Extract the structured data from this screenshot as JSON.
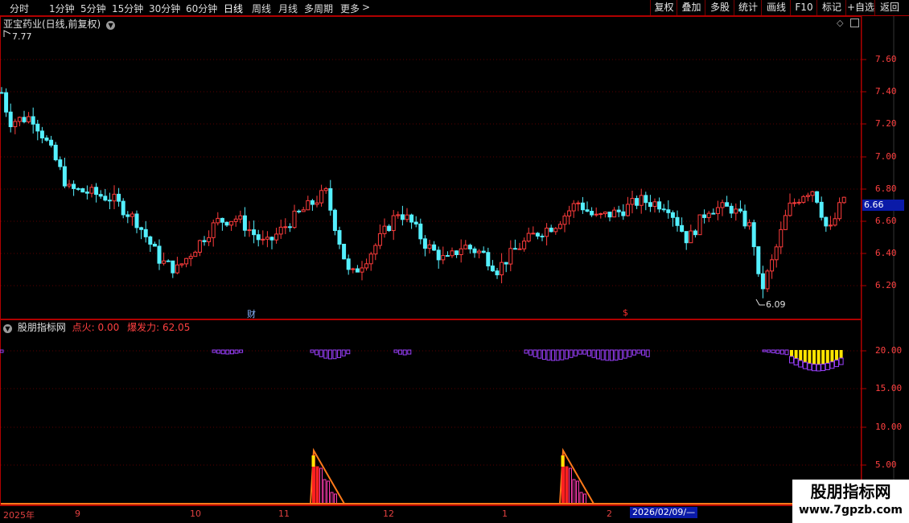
{
  "toolbar": {
    "periods": [
      {
        "label": "分时",
        "x": 12
      },
      {
        "label": "1分钟",
        "x": 61
      },
      {
        "label": "5分钟",
        "x": 100
      },
      {
        "label": "15分钟",
        "x": 139
      },
      {
        "label": "30分钟",
        "x": 185
      },
      {
        "label": "60分钟",
        "x": 231
      },
      {
        "label": "日线",
        "x": 278,
        "active": true
      },
      {
        "label": "周线",
        "x": 313
      },
      {
        "label": "月线",
        "x": 346
      },
      {
        "label": "多周期",
        "x": 378
      },
      {
        "label": "更多",
        "x": 423
      }
    ],
    "more_arrow": ">",
    "buttons": [
      "复权",
      "叠加",
      "多股",
      "统计",
      "画线",
      "F10",
      "标记",
      "+自选",
      "返回"
    ]
  },
  "main": {
    "title": "亚宝药业(日线,前复权)",
    "high_label": "7.77",
    "low_label": "6.09",
    "current_price": "6.66",
    "y_ticks": [
      "7.60",
      "7.40",
      "7.20",
      "7.00",
      "6.80",
      "6.60",
      "6.40",
      "6.20"
    ],
    "markers": [
      "财",
      "$"
    ]
  },
  "indicator": {
    "title": "股朋指标网",
    "param1_label": "点火:",
    "param1_value": "0.00",
    "param2_label": "爆发力:",
    "param2_value": "62.05",
    "y_ticks": [
      "20.00",
      "15.00",
      "10.00",
      "5.00"
    ]
  },
  "dates": [
    "2025年",
    "9",
    "10",
    "11",
    "12",
    "1",
    "2"
  ],
  "cursor_date": "2026/02/09/—",
  "watermark": {
    "title": "股朋指标网",
    "url": "www.7gpzb.com"
  },
  "colors": {
    "up": "#ff3c3c",
    "down": "#54f0ff",
    "frame": "#b00000",
    "purple": "#9b40ff",
    "yellow": "#ffe400"
  }
}
